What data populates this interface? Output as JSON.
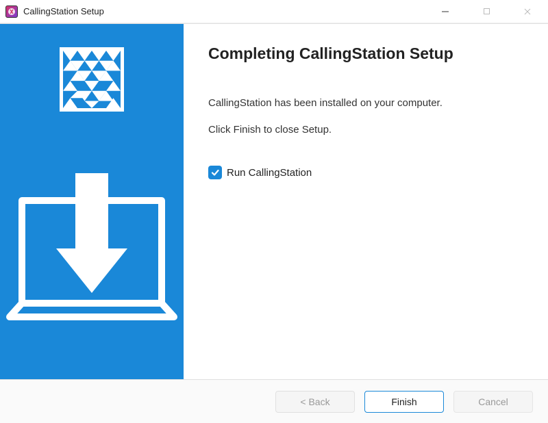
{
  "window": {
    "title": "CallingStation Setup"
  },
  "main": {
    "heading": "Completing CallingStation Setup",
    "line1": "CallingStation has been installed on your computer.",
    "line2": "Click Finish to close Setup.",
    "checkbox_label": "Run CallingStation",
    "checkbox_checked": true
  },
  "footer": {
    "back": "< Back",
    "finish": "Finish",
    "cancel": "Cancel"
  },
  "colors": {
    "accent": "#1a88d8"
  }
}
